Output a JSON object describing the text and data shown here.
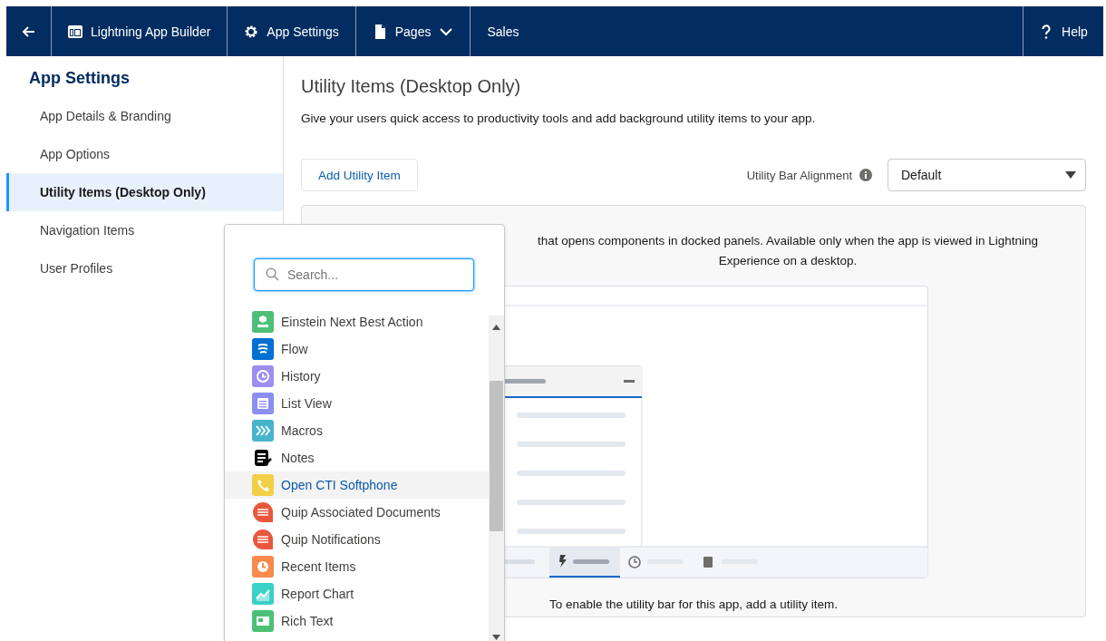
{
  "top_nav": {
    "items": [
      {
        "kind": "back"
      },
      {
        "kind": "builder",
        "label": "Lightning App Builder"
      },
      {
        "kind": "settings",
        "label": "App Settings"
      },
      {
        "kind": "pages",
        "label": "Pages"
      },
      {
        "kind": "plain",
        "label": "Sales"
      }
    ],
    "help": {
      "label": "Help"
    }
  },
  "sidebar": {
    "title": "App Settings",
    "items": [
      {
        "label": "App Details & Branding",
        "selected": false
      },
      {
        "label": "App Options",
        "selected": false
      },
      {
        "label": "Utility Items (Desktop Only)",
        "selected": true
      },
      {
        "label": "Navigation Items",
        "selected": false
      },
      {
        "label": "User Profiles",
        "selected": false
      }
    ]
  },
  "main": {
    "title": "Utility Items (Desktop Only)",
    "subtitle": "Give your users quick access to productivity tools and add background utility items to your app.",
    "add_button": "Add Utility Item",
    "alignment": {
      "label": "Utility Bar Alignment",
      "value": "Default"
    },
    "panel": {
      "description": "that opens components in docked panels. Available only when the app is viewed in Lightning Experience on a desktop.",
      "footer": "To enable the utility bar for this app, add a utility item."
    }
  },
  "popover": {
    "search": {
      "placeholder": "Search..."
    },
    "items": [
      {
        "label": "Einstein Next Best Action",
        "kind": "tile",
        "color": "#4bc076",
        "selected": false
      },
      {
        "label": "Flow",
        "kind": "tile",
        "color": "#0070d2",
        "selected": false
      },
      {
        "label": "History",
        "kind": "tile",
        "color": "#9c8ff0",
        "selected": false
      },
      {
        "label": "List View",
        "kind": "tile",
        "color": "#8b8ff0",
        "selected": false
      },
      {
        "label": "Macros",
        "kind": "tile",
        "color": "#47b4cb",
        "selected": false
      },
      {
        "label": "Notes",
        "kind": "plain",
        "color": "#080707",
        "selected": false
      },
      {
        "label": "Open CTI Softphone",
        "kind": "tile",
        "color": "#f2cf46",
        "selected": true
      },
      {
        "label": "Quip Associated Documents",
        "kind": "bubble",
        "color": "#e9573e",
        "selected": false
      },
      {
        "label": "Quip Notifications",
        "kind": "bubble",
        "color": "#e9573e",
        "selected": false
      },
      {
        "label": "Recent Items",
        "kind": "tile",
        "color": "#f88b4b",
        "selected": false
      },
      {
        "label": "Report Chart",
        "kind": "tile",
        "color": "#3bd0c8",
        "selected": false
      },
      {
        "label": "Rich Text",
        "kind": "tile",
        "color": "#4bc076",
        "selected": false
      }
    ]
  }
}
